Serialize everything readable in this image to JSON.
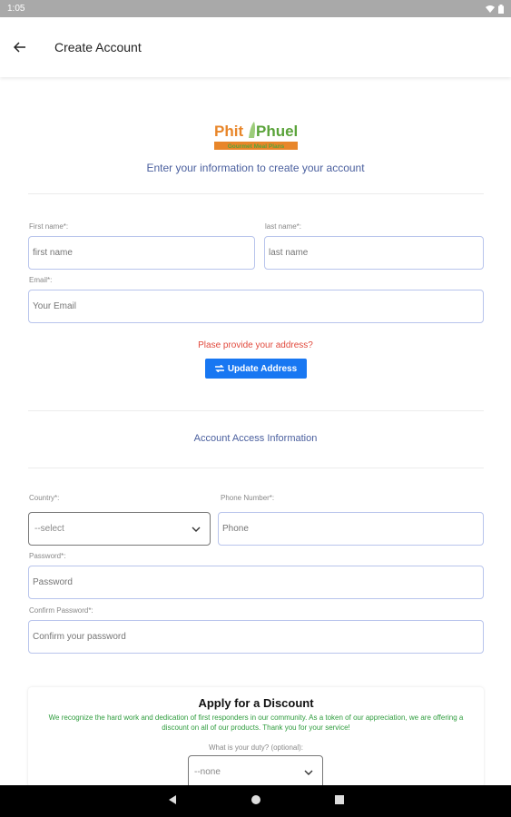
{
  "status_bar": {
    "time": "1:05"
  },
  "app_bar": {
    "title": "Create Account"
  },
  "logo": {
    "line1": "Phit",
    "line2": "Phuel",
    "tagline": "Gourmet Meal Plans"
  },
  "subtitle": "Enter your information to create your account",
  "form": {
    "first_name": {
      "label": "First name*:",
      "placeholder": "first name"
    },
    "last_name": {
      "label": "last name*:",
      "placeholder": "last name"
    },
    "email": {
      "label": "Email*:",
      "placeholder": "Your Email"
    },
    "address_warning": "Plase provide your address?",
    "update_address_label": "Update Address",
    "access_section_title": "Account Access Information",
    "country": {
      "label": "Country*:",
      "value": "--select"
    },
    "phone": {
      "label": "Phone Number*:",
      "placeholder": "Phone"
    },
    "password": {
      "label": "Password*:",
      "placeholder": "Password"
    },
    "confirm_password": {
      "label": "Confirm Password*:",
      "placeholder": "Confirm your password"
    }
  },
  "discount": {
    "title": "Apply for a Discount",
    "text": "We recognize the hard work and dedication of first responders in our community. As a token of our appreciation, we are offering a discount on all of our products. Thank you for your service!",
    "duty_label": "What is your duty? (optional):",
    "duty_value": "--none"
  },
  "colors": {
    "accent": "#1877f2",
    "link_text": "#4a5f9e",
    "warning": "#e14a3d",
    "discount_text": "#2e9c3d",
    "input_border": "#b8c4ec"
  },
  "icons": {
    "back": "arrow-left-icon",
    "chevron": "chevron-down-icon",
    "swap": "swap-icon",
    "wifi": "wifi-icon",
    "battery": "battery-icon"
  }
}
